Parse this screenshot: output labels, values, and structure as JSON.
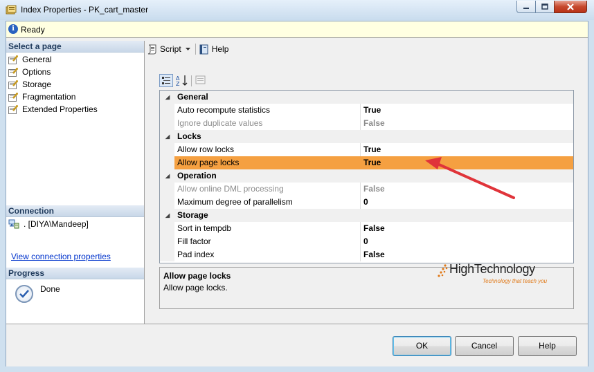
{
  "window": {
    "title": "Index Properties - PK_cart_master"
  },
  "status": {
    "text": "Ready"
  },
  "left": {
    "select_page_header": "Select a page",
    "pages": [
      {
        "label": "General"
      },
      {
        "label": "Options"
      },
      {
        "label": "Storage"
      },
      {
        "label": "Fragmentation"
      },
      {
        "label": "Extended Properties"
      }
    ],
    "connection_header": "Connection",
    "connection_name": ". [DIYA\\Mandeep]",
    "view_connection_link": "View connection properties",
    "progress_header": "Progress",
    "progress_status": "Done"
  },
  "toolbar": {
    "script_label": "Script",
    "help_label": "Help"
  },
  "grid": {
    "categories": [
      {
        "name": "General",
        "props": [
          {
            "name": "Auto recompute statistics",
            "value": "True",
            "disabled": false,
            "selected": false
          },
          {
            "name": "Ignore duplicate values",
            "value": "False",
            "disabled": true,
            "selected": false
          }
        ]
      },
      {
        "name": "Locks",
        "props": [
          {
            "name": "Allow row locks",
            "value": "True",
            "disabled": false,
            "selected": false
          },
          {
            "name": "Allow page locks",
            "value": "True",
            "disabled": false,
            "selected": true
          }
        ]
      },
      {
        "name": "Operation",
        "props": [
          {
            "name": "Allow online DML processing",
            "value": "False",
            "disabled": true,
            "selected": false
          },
          {
            "name": "Maximum degree of parallelism",
            "value": "0",
            "disabled": false,
            "selected": false
          }
        ]
      },
      {
        "name": "Storage",
        "props": [
          {
            "name": "Sort in tempdb",
            "value": "False",
            "disabled": false,
            "selected": false
          },
          {
            "name": "Fill factor",
            "value": "0",
            "disabled": false,
            "selected": false
          },
          {
            "name": "Pad index",
            "value": "False",
            "disabled": false,
            "selected": false
          }
        ]
      }
    ]
  },
  "description": {
    "title": "Allow page locks",
    "text": "Allow page locks."
  },
  "watermark": {
    "brand": "HighTechnology",
    "tagline": "Technology that teach you"
  },
  "buttons": {
    "ok": "OK",
    "cancel": "Cancel",
    "help": "Help"
  },
  "colors": {
    "selected_row": "#f5a041",
    "annotation_arrow": "#e0343a"
  }
}
